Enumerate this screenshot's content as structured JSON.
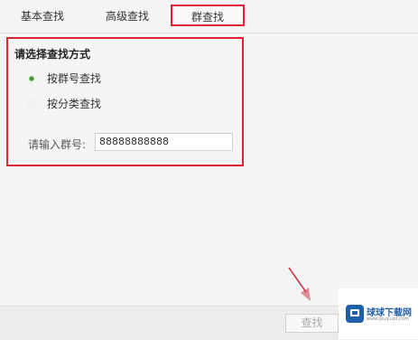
{
  "tabs": [
    {
      "label": "基本查找"
    },
    {
      "label": "高级查找"
    },
    {
      "label": "群查找",
      "selected": true
    }
  ],
  "panel": {
    "title": "请选择查找方式",
    "options": [
      {
        "label": "按群号查找",
        "checked": true
      },
      {
        "label": "按分类查找",
        "checked": false
      }
    ],
    "group_number": {
      "label": "请输入群号:",
      "value": "88888888888"
    }
  },
  "footer": {
    "search_label": "查找"
  },
  "watermark": {
    "text": "球球下载网",
    "sub": "www.qiuqiuxz.com"
  },
  "colors": {
    "highlight_border": "#e02236",
    "radio_checked": "#3f9a2f",
    "arrow": "#c8394a",
    "watermark_blue": "#1f5fa8"
  }
}
